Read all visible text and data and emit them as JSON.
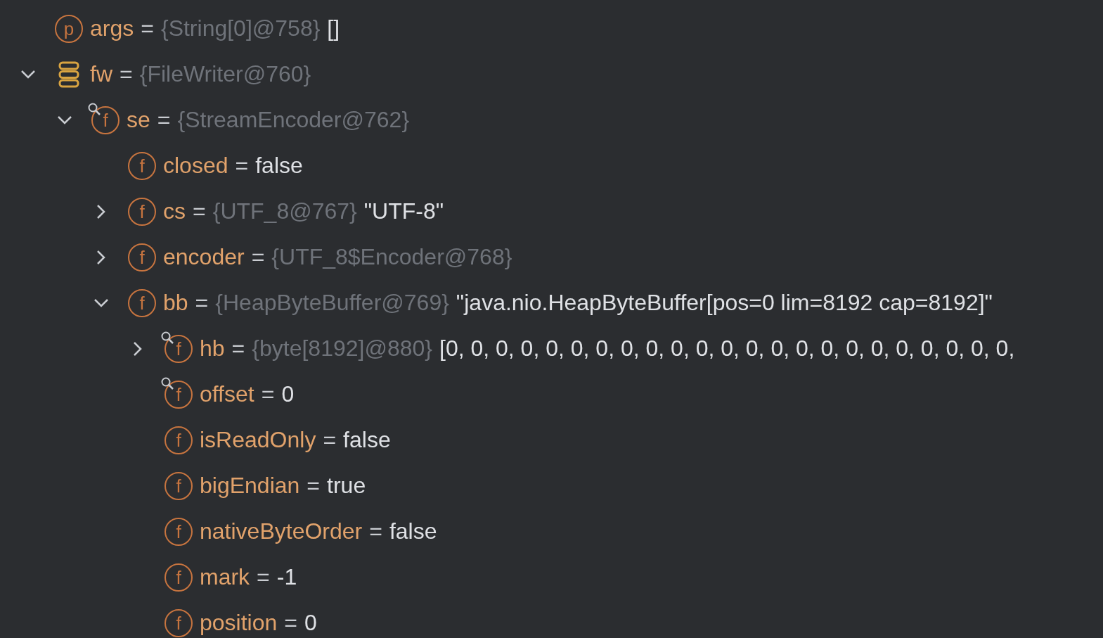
{
  "variables": [
    {
      "kind": "parameter",
      "badge": "p",
      "name": "args",
      "operator": "=",
      "type_ref": "{String[0]@758}",
      "value": "[]"
    },
    {
      "kind": "object",
      "name": "fw",
      "operator": "=",
      "type_ref": "{FileWriter@760}",
      "expanded": true,
      "children": [
        {
          "kind": "field",
          "restricted": true,
          "badge": "f",
          "name": "se",
          "operator": "=",
          "type_ref": "{StreamEncoder@762}",
          "expanded": true,
          "children": [
            {
              "kind": "field",
              "restricted": false,
              "badge": "f",
              "name": "closed",
              "operator": "=",
              "value": "false"
            },
            {
              "kind": "field",
              "restricted": false,
              "badge": "f",
              "name": "cs",
              "operator": "=",
              "type_ref": "{UTF_8@767}",
              "value": "\"UTF-8\"",
              "expanded": false
            },
            {
              "kind": "field",
              "restricted": false,
              "badge": "f",
              "name": "encoder",
              "operator": "=",
              "type_ref": "{UTF_8$Encoder@768}",
              "expanded": false
            },
            {
              "kind": "field",
              "restricted": false,
              "badge": "f",
              "name": "bb",
              "operator": "=",
              "type_ref": "{HeapByteBuffer@769}",
              "value": "\"java.nio.HeapByteBuffer[pos=0 lim=8192 cap=8192]\"",
              "expanded": true,
              "children": [
                {
                  "kind": "field",
                  "restricted": true,
                  "badge": "f",
                  "name": "hb",
                  "operator": "=",
                  "type_ref": "{byte[8192]@880}",
                  "value": "[0, 0, 0, 0, 0, 0, 0, 0, 0, 0, 0, 0, 0, 0, 0, 0, 0, 0, 0, 0, 0, 0, 0,",
                  "expanded": false
                },
                {
                  "kind": "field",
                  "restricted": true,
                  "badge": "f",
                  "name": "offset",
                  "operator": "=",
                  "value": "0"
                },
                {
                  "kind": "field",
                  "restricted": false,
                  "badge": "f",
                  "name": "isReadOnly",
                  "operator": "=",
                  "value": "false"
                },
                {
                  "kind": "field",
                  "restricted": false,
                  "badge": "f",
                  "name": "bigEndian",
                  "operator": "=",
                  "value": "true"
                },
                {
                  "kind": "field",
                  "restricted": false,
                  "badge": "f",
                  "name": "nativeByteOrder",
                  "operator": "=",
                  "value": "false"
                },
                {
                  "kind": "field",
                  "restricted": false,
                  "badge": "f",
                  "name": "mark",
                  "operator": "=",
                  "value": "-1"
                },
                {
                  "kind": "field",
                  "restricted": false,
                  "badge": "f",
                  "name": "position",
                  "operator": "=",
                  "value": "0"
                }
              ]
            }
          ]
        }
      ]
    }
  ]
}
